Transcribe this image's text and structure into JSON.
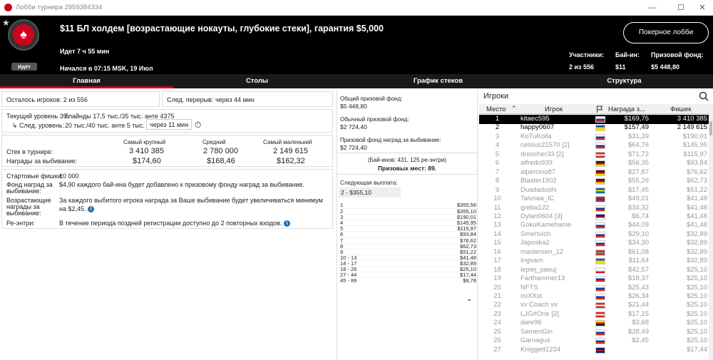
{
  "window": {
    "title": "Лобби турнира 2959384334",
    "minimize": "—",
    "maximize": "☐",
    "close": "✕"
  },
  "header": {
    "title": "$11 БЛ холдем [возрастающие нокауты, глубокие стеки], гарантия $5,000",
    "running": "Идет 7 ч 55 мин",
    "started": "Начался в 07:15 MSK, 19 Июл",
    "status": "Идёт",
    "lobby_button": "Покерное лобби",
    "participants_label": "Участники:",
    "participants_value": "2 из 556",
    "buyin_label": "Бай-ин:",
    "buyin_value": "$11",
    "prizepool_label": "Призовой фонд:",
    "prizepool_value": "$5 448,80"
  },
  "tabs": [
    "Главная",
    "Столы",
    "График стеков",
    "Структура"
  ],
  "left": {
    "players_left": "Осталось игроков: 2 из 556",
    "next_break": "След. перерыв: через 44 мин",
    "current_level_label": "Текущий уровень 39:",
    "current_level_value": "блайнды 17,5 тыс./35 тыс. анте  4375",
    "next_level_label": "↳ След. уровень:",
    "next_level_value": "20 тыс./40 тыс. анте  5 тыс.",
    "next_level_time": "через 11 мин",
    "col_largest": "Самый крупный",
    "col_average": "Средний",
    "col_smallest": "Самый маленький",
    "stack_label": "Стек в турнире:",
    "stack_largest": "3 410 385",
    "stack_average": "2 780 000",
    "stack_smallest": "2 149 615",
    "bounty_label": "Награды за выбивание:",
    "bounty_largest": "$174,60",
    "bounty_average": "$168,46",
    "bounty_smallest": "$162,32",
    "start_chips_label": "Стартовые фишки:",
    "start_chips_value": "10 000",
    "bounty_fund_label_1": "Фонд наград за",
    "bounty_fund_label_2": "выбивание:",
    "bounty_fund_value": "$4,90 каждого бай-ина будет добавлено к призовому фонду наград за выбивание.",
    "prog_label_1": "Возрастающие",
    "prog_label_2": "награды за",
    "prog_label_3": "выбивание:",
    "prog_value_1": "За каждого выбитого игрока награда за Ваше выбивание будет увеличиваться минимум",
    "prog_value_2": "на $2,45.",
    "reentry_label": "Ре-энтри:",
    "reentry_value": "В течение периода поздней регистрации доступно до 2 повторных входов.",
    "info_glyph": "i"
  },
  "middle": {
    "total_prize_label": "Общий призовой фонд:",
    "total_prize_value": "$5 448,80",
    "regular_prize_label": "Обычный призовой фонд:",
    "regular_prize_value": "$2 724,40",
    "bounty_prize_label": "Призовой фонд наград за выбивание:",
    "bounty_prize_value": "$2 724,40",
    "buyins_note": "(Бай-инов: 431, 125 ре-энтри)",
    "paid_places": "Призовых мест: 89.",
    "next_payout_label": "Следующая выплата:",
    "next_payout_value": "2 - $355,10",
    "payouts": [
      {
        "place": "1",
        "amount": "$355,56"
      },
      {
        "place": "2",
        "amount": "$355,10"
      },
      {
        "place": "3",
        "amount": "$190,01"
      },
      {
        "place": "4",
        "amount": "$145,95"
      },
      {
        "place": "5",
        "amount": "$115,97"
      },
      {
        "place": "6",
        "amount": "$93,84"
      },
      {
        "place": "7",
        "amount": "$76,62"
      },
      {
        "place": "8",
        "amount": "$62,73"
      },
      {
        "place": "9",
        "amount": "$51,22"
      },
      {
        "place": "10 - 13",
        "amount": "$41,48"
      },
      {
        "place": "14 - 17",
        "amount": "$32,89"
      },
      {
        "place": "18 - 26",
        "amount": "$25,10"
      },
      {
        "place": "27 - 44",
        "amount": "$17,44"
      },
      {
        "place": "45 - 89",
        "amount": "$9,78"
      }
    ],
    "collapse_glyph": "⌃"
  },
  "players": {
    "title": "Игроки",
    "search_icon": "search-icon",
    "col_place": "Место",
    "col_player": "Игрок",
    "col_bounty": "Награда з...",
    "col_chips": "Фишек",
    "sort_glyph": "⌃",
    "rows": [
      {
        "place": "1",
        "name": "kitaec595",
        "bounty": "$169,75",
        "chips": "3 410 385",
        "flag": [
          "#fff",
          "#0039a6",
          "#d52b1e"
        ]
      },
      {
        "place": "2",
        "name": "happy0607",
        "bounty": "$157,49",
        "chips": "2 149 615",
        "flag": [
          "#0057b7",
          "#ffd700",
          "#ffd700"
        ]
      },
      {
        "place": "3",
        "name": "KoTuKolla",
        "bounty": "$31,39",
        "chips": "$190,01",
        "flag": [
          "#fff",
          "#0039a6",
          "#d52b1e"
        ]
      },
      {
        "place": "4",
        "name": "celsius21570 [2]",
        "bounty": "$64,76",
        "chips": "$145,95",
        "flag": [
          "#fff",
          "#0039a6",
          "#d52b1e"
        ]
      },
      {
        "place": "5",
        "name": "drescher33 [2]",
        "bounty": "$71,72",
        "chips": "$115,97",
        "flag": [
          "#d52b1e",
          "#fff",
          "#d52b1e"
        ]
      },
      {
        "place": "6",
        "name": "alfredo939",
        "bounty": "$56,35",
        "chips": "$93,84",
        "flag": [
          "#222",
          "#dd0000",
          "#ffce00"
        ]
      },
      {
        "place": "7",
        "name": "alpercino87",
        "bounty": "$27,87",
        "chips": "$76,62",
        "flag": [
          "#222",
          "#dd0000",
          "#ffce00"
        ]
      },
      {
        "place": "8",
        "name": "Blaster1902",
        "bounty": "$55,26",
        "chips": "$62,73",
        "flag": [
          "#222",
          "#dd0000",
          "#ffce00"
        ]
      },
      {
        "place": "9",
        "name": "Duadadushi",
        "bounty": "$17,45",
        "chips": "$51,22",
        "flag": [
          "#006aa7",
          "#fecc00",
          "#006aa7"
        ]
      },
      {
        "place": "10",
        "name": "Taivnaa_IC",
        "bounty": "$49,01",
        "chips": "$41,48",
        "flag": [
          "#c4272f",
          "#015197",
          "#c4272f"
        ]
      },
      {
        "place": "11",
        "name": "greba122",
        "bounty": "$34,32",
        "chips": "$41,48",
        "flag": [
          "#fff",
          "#0039a6",
          "#d52b1e"
        ]
      },
      {
        "place": "12",
        "name": "Dylan0604 [3]",
        "bounty": "$6,74",
        "chips": "$41,48",
        "flag": [
          "#002868",
          "#bf0a30",
          "#fff"
        ]
      },
      {
        "place": "13",
        "name": "GokuKamehame",
        "bounty": "$44,09",
        "chips": "$41,48",
        "flag": [
          "#fff",
          "#0039a6",
          "#d52b1e"
        ]
      },
      {
        "place": "14",
        "name": "Smertvich",
        "bounty": "$29,10",
        "chips": "$32,89",
        "flag": [
          "#fff",
          "#0039a6",
          "#d52b1e"
        ]
      },
      {
        "place": "15",
        "name": "Japoska2",
        "bounty": "$34,30",
        "chips": "$32,89",
        "flag": [
          "#fff",
          "#0039a6",
          "#d52b1e"
        ]
      },
      {
        "place": "16",
        "name": "mastersen_12",
        "bounty": "$61,08",
        "chips": "$32,89",
        "flag": [
          "#c8313e",
          "#4aa657",
          "#c8313e"
        ]
      },
      {
        "place": "17",
        "name": "Ingvarn",
        "bounty": "$11,64",
        "chips": "$32,89",
        "flag": [
          "#0057b7",
          "#ffd700",
          "#ffd700"
        ]
      },
      {
        "place": "18",
        "name": "lepiej_pasuj",
        "bounty": "$42,57",
        "chips": "$25,10",
        "flag": [
          "#fff",
          "#fff",
          "#dc143c"
        ]
      },
      {
        "place": "19",
        "name": "Farthammer13",
        "bounty": "$18,37",
        "chips": "$25,10",
        "flag": [
          "#fff",
          "#0039a6",
          "#d52b1e"
        ]
      },
      {
        "place": "20",
        "name": "NFTS",
        "bounty": "$25,43",
        "chips": "$25,10",
        "flag": [
          "#fff",
          "#0039a6",
          "#d52b1e"
        ]
      },
      {
        "place": "21",
        "name": "miXXst",
        "bounty": "$26,34",
        "chips": "$25,10",
        "flag": [
          "#fff",
          "#0039a6",
          "#d52b1e"
        ]
      },
      {
        "place": "22",
        "name": "vv Coach vv",
        "bounty": "$21,44",
        "chips": "$25,10",
        "flag": [
          "#d52b1e",
          "#fff",
          "#d52b1e"
        ]
      },
      {
        "place": "23",
        "name": "LJG#One [2]",
        "bounty": "$17,15",
        "chips": "$25,10",
        "flag": [
          "#d52b1e",
          "#fff",
          "#d52b1e"
        ]
      },
      {
        "place": "24",
        "name": "dare96",
        "bounty": "$3,68",
        "chips": "$25,10",
        "flag": [
          "#ffce00",
          "#dd0000",
          "#222"
        ]
      },
      {
        "place": "25",
        "name": "SemenGin",
        "bounty": "$28,49",
        "chips": "$25,10",
        "flag": [
          "#fff",
          "#0039a6",
          "#d52b1e"
        ]
      },
      {
        "place": "26",
        "name": "Garnagus",
        "bounty": "$2,45",
        "chips": "$25,10",
        "flag": [
          "#fff",
          "#0039a6",
          "#d52b1e"
        ]
      },
      {
        "place": "27",
        "name": "Kniggett1234",
        "bounty": "",
        "chips": "$17,44",
        "flag": [
          "#012169",
          "#c8102e",
          "#012169"
        ]
      }
    ]
  }
}
